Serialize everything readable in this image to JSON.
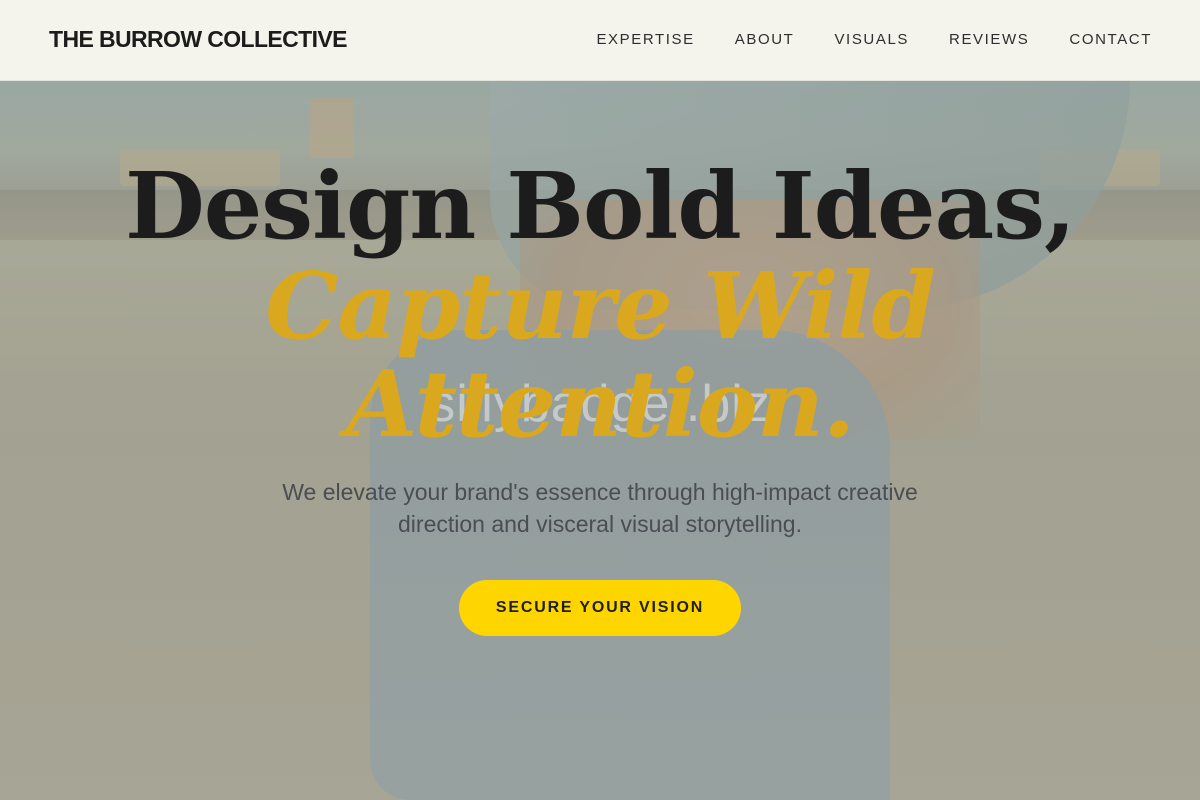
{
  "header": {
    "brand": "THE BURROW COLLECTIVE",
    "nav": [
      {
        "label": "EXPERTISE"
      },
      {
        "label": "ABOUT"
      },
      {
        "label": "VISUALS"
      },
      {
        "label": "REVIEWS"
      },
      {
        "label": "CONTACT"
      }
    ]
  },
  "hero": {
    "headline_line1": "Design Bold Ideas,",
    "headline_line2": "Capture Wild",
    "headline_line3": "Attention.",
    "watermark": "sillybadger.biz",
    "subtext": "We elevate your brand's essence through high-impact creative direction and visceral visual storytelling.",
    "cta_label": "SECURE YOUR VISION"
  },
  "colors": {
    "accent": "#d9a81e",
    "cta": "#ffd500",
    "header_bg": "#faf9f2",
    "text_dark": "#1c1c1c"
  }
}
